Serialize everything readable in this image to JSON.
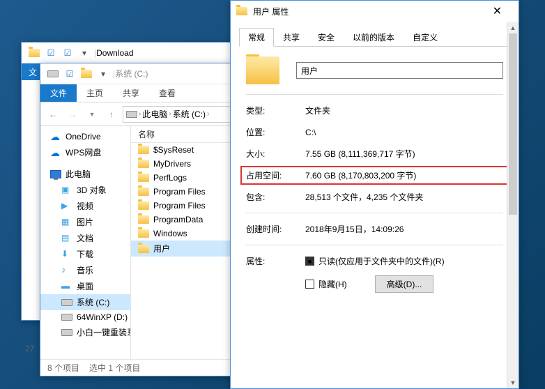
{
  "win1": {
    "title": "Download",
    "file_tab": "文"
  },
  "win2": {
    "title": "系统 (C:)",
    "tabs": {
      "file": "文件",
      "home": "主页",
      "share": "共享",
      "view": "查看"
    },
    "breadcrumb": [
      "此电脑",
      "系统 (C:)"
    ],
    "list_header": "名称",
    "tree": {
      "onedrive": "OneDrive",
      "wps": "WPS网盘",
      "pc": "此电脑",
      "obj3d": "3D 对象",
      "video": "视频",
      "pics": "图片",
      "docs": "文档",
      "downloads": "下载",
      "music": "音乐",
      "desktop": "桌面",
      "cdrive": "系统 (C:)",
      "ddrive": "64WinXP  (D:)",
      "reinstall": "小白一键重装系"
    },
    "files": [
      "$SysReset",
      "MyDrivers",
      "PerfLogs",
      "Program Files",
      "Program Files",
      "ProgramData",
      "Windows",
      "用户"
    ],
    "status": {
      "count": "8 个项目",
      "sel": "选中 1 个项目"
    },
    "count_partial": "27"
  },
  "win3": {
    "title": "用户 属性",
    "tabs": [
      "常规",
      "共享",
      "安全",
      "以前的版本",
      "自定义"
    ],
    "name": "用户",
    "rows": {
      "type_l": "类型:",
      "type_v": "文件夹",
      "loc_l": "位置:",
      "loc_v": "C:\\",
      "size_l": "大小:",
      "size_v": "7.55 GB (8,111,369,717 字节)",
      "disk_l": "占用空间:",
      "disk_v": "7.60 GB (8,170,803,200 字节)",
      "contains_l": "包含:",
      "contains_v": "28,513 个文件，4,235 个文件夹",
      "created_l": "创建时间:",
      "created_v": "2018年9月15日，14:09:26",
      "attr_l": "属性:",
      "readonly": "只读(仅应用于文件夹中的文件)(R)",
      "hidden": "隐藏(H)",
      "advanced": "高级(D)..."
    }
  }
}
